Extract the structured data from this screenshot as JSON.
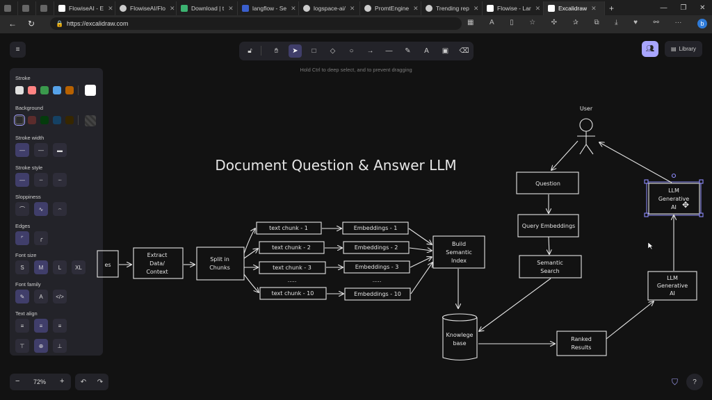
{
  "browser": {
    "tabs": [
      {
        "label": "",
        "color": "#5b5b5b"
      },
      {
        "label": "",
        "color": "#5b5b5b"
      },
      {
        "label": "FlowiseAI - E",
        "color": "#ffffff"
      },
      {
        "label": "FlowiseAI/Flo",
        "color": "#cccccc"
      },
      {
        "label": "Download | t",
        "color": "#3cb371"
      },
      {
        "label": "langflow - Se",
        "color": "#3a5fcd"
      },
      {
        "label": "logspace-ai/",
        "color": "#cccccc"
      },
      {
        "label": "PromtEngine",
        "color": "#cccccc"
      },
      {
        "label": "Trending rep",
        "color": "#cccccc"
      },
      {
        "label": "Flowise - Lar",
        "color": "#ffffff"
      },
      {
        "label": "Excalidraw",
        "color": "#ffffff"
      }
    ],
    "new_tab": "+",
    "url": "https://excalidraw.com"
  },
  "top": {
    "library_label": "Library",
    "hint": "Hold Ctrl to deep select, and to prevent dragging"
  },
  "panel": {
    "stroke_label": "Stroke",
    "background_label": "Background",
    "stroke_width_label": "Stroke width",
    "stroke_style_label": "Stroke style",
    "sloppiness_label": "Sloppiness",
    "edges_label": "Edges",
    "font_size_label": "Font size",
    "font_family_label": "Font family",
    "text_align_label": "Text align",
    "font_sizes": [
      "S",
      "M",
      "L",
      "XL"
    ],
    "stroke_colors": [
      "#e0e0e0",
      "#ff8383",
      "#3a994c",
      "#56a2e8",
      "#b76100",
      "#ffffff"
    ],
    "background_colors": [
      "#2b2b2b",
      "#5b2c2c",
      "#043b0c",
      "#154163",
      "#362600",
      "#444444"
    ]
  },
  "zoom": {
    "minus": "−",
    "value": "72%",
    "plus": "+"
  },
  "diagram": {
    "title": "Document Question & Answer LLM",
    "user_label": "User",
    "files_label": "es",
    "extract": [
      "Extract",
      "Data/",
      "Context"
    ],
    "split": [
      "Split in",
      "Chunks"
    ],
    "chunks": [
      "text chunk - 1",
      "text chunk - 2",
      "text chunk - 3",
      ".....",
      "text chunk - 10"
    ],
    "embeddings": [
      "Embeddings - 1",
      "Embeddings - 2",
      "Embeddings - 3",
      ".....",
      "Embeddings - 10"
    ],
    "index": [
      "Build",
      "Semantic",
      "Index"
    ],
    "kb": [
      "Knowlege",
      "base"
    ],
    "ranked": [
      "Ranked",
      "Results"
    ],
    "question": "Question",
    "query_emb": "Query Embeddings",
    "search": [
      "Semantic",
      "Search"
    ],
    "llm_bottom": [
      "LLM",
      "Generative",
      "AI"
    ],
    "llm_top": [
      "LLM",
      "Generative",
      "AI"
    ]
  }
}
